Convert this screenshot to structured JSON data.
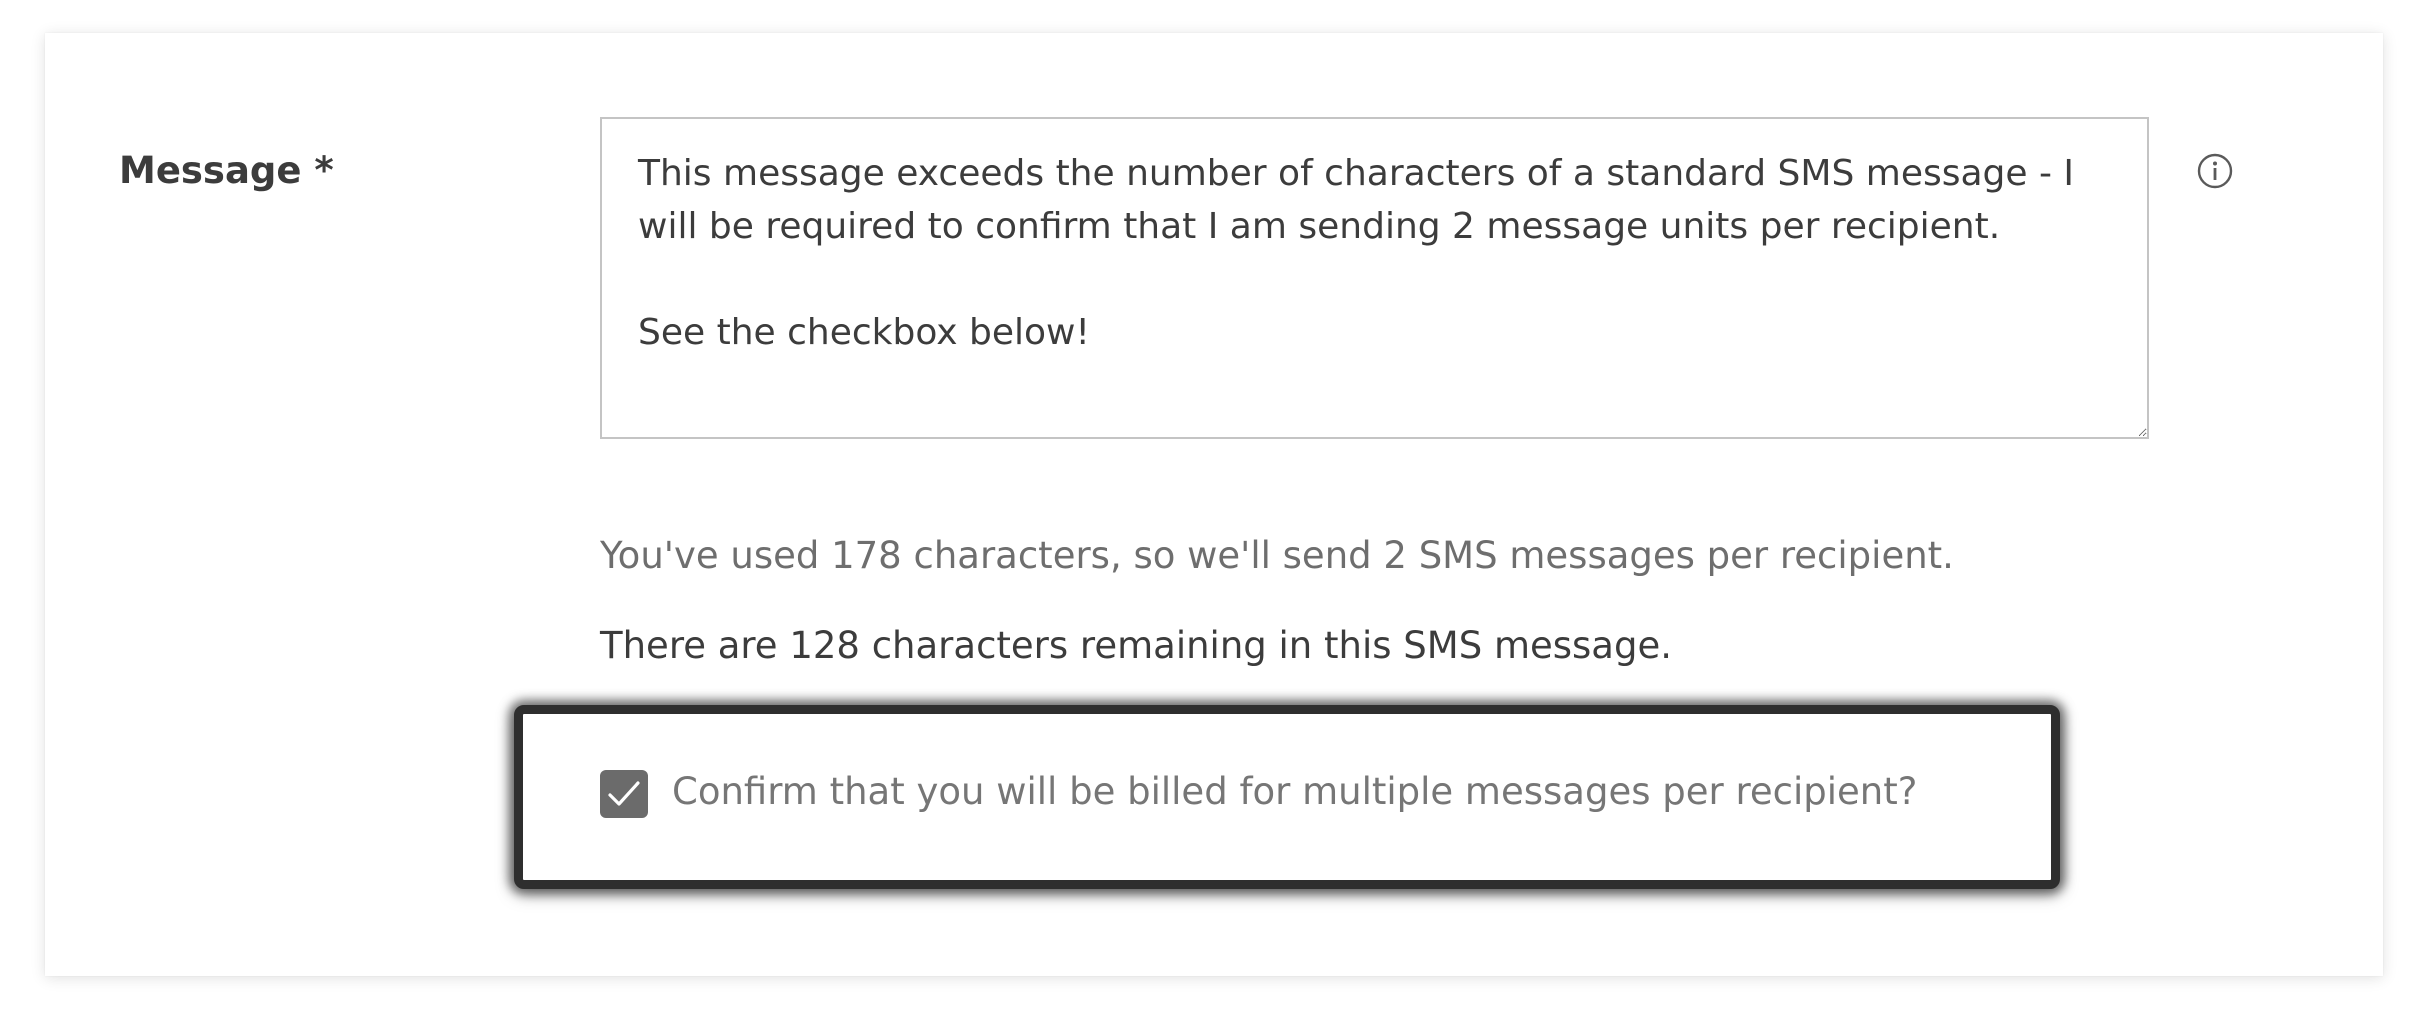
{
  "form": {
    "message_label": "Message *",
    "message_value": "This message exceeds the number of characters of a standard SMS message - I will be required to confirm that I am sending 2 message units per recipient.\n\nSee the checkbox below!",
    "info_icon": "info-circle-icon",
    "char_usage_text": "You've used 178 characters, so we'll send 2 SMS messages per recipient.",
    "char_remaining_text": "There are 128 characters remaining in this SMS message.",
    "confirm_checkbox": {
      "checked": true,
      "label": "Confirm that you will be billed for multiple messages per recipient?"
    }
  },
  "colors": {
    "label_text": "#3c3c3c",
    "helper_text": "#6e6e6e",
    "checkbox_fill": "#6b6b6b",
    "highlight_border": "#2e2e2e"
  }
}
